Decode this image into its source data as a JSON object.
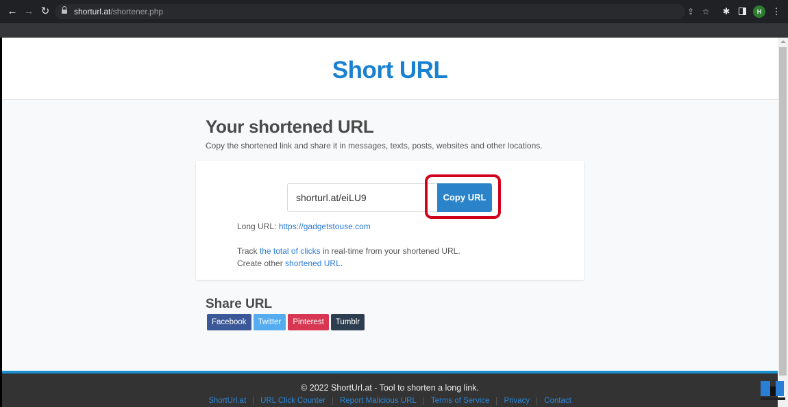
{
  "browser": {
    "url_host": "shorturl.at",
    "url_path": "/shortener.php",
    "profile_initial": "H",
    "profile_color": "#2e7d32"
  },
  "header": {
    "site_title": "Short URL",
    "title_color": "#1a80d0"
  },
  "result": {
    "heading": "Your shortened URL",
    "description": "Copy the shortened link and share it in messages, texts, posts, websites and other locations.",
    "short_url_value": "shorturl.at/eiLU9",
    "copy_button_label": "Copy URL",
    "long_url_label": "Long URL: ",
    "long_url_link": "https://gadgetstouse.com",
    "track_prefix": "Track ",
    "track_link": "the total of clicks",
    "track_suffix": " in real-time from your shortened URL.",
    "create_prefix": "Create other ",
    "create_link": "shortened URL",
    "create_suffix": "."
  },
  "share": {
    "heading": "Share URL",
    "buttons": [
      {
        "label": "Facebook",
        "color": "#3b5998"
      },
      {
        "label": "Twitter",
        "color": "#55acee"
      },
      {
        "label": "Pinterest",
        "color": "#d73753"
      },
      {
        "label": "Tumblr",
        "color": "#2c3e50"
      }
    ]
  },
  "footer": {
    "copyright": "© 2022 ShortUrl.at - Tool to shorten a long link.",
    "links": [
      "ShortUrl.at",
      "URL Click Counter",
      "Report Malicious URL",
      "Terms of Service",
      "Privacy",
      "Contact"
    ]
  },
  "icons": {
    "back": "←",
    "forward": "→",
    "reload": "↻",
    "share": "⇪",
    "star": "☆",
    "extensions": "✱",
    "menu": "⋮"
  }
}
